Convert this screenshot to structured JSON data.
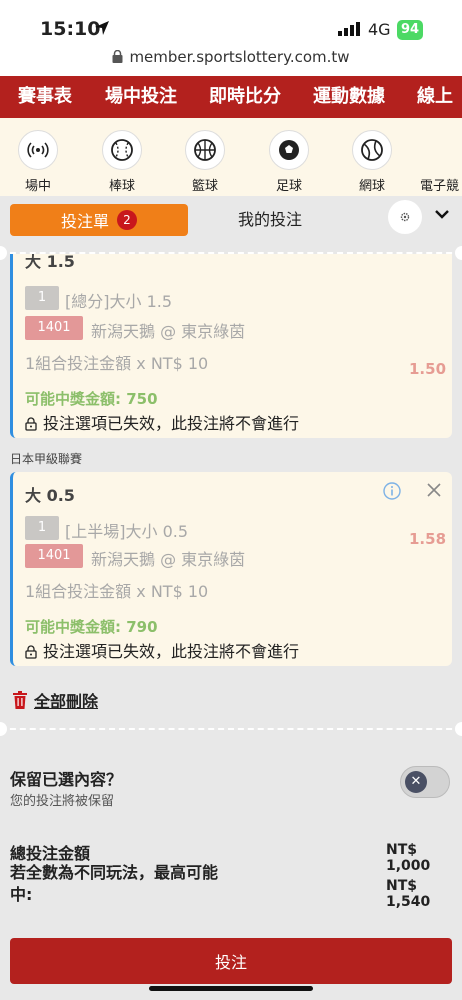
{
  "status": {
    "time": "15:10",
    "network": "4G",
    "battery": "94"
  },
  "url": "member.sportslottery.com.tw",
  "topnav": [
    "賽事表",
    "場中投注",
    "即時比分",
    "運動數據",
    "線上"
  ],
  "sports": [
    {
      "label": "場中",
      "icon": "live-signal-icon"
    },
    {
      "label": "棒球",
      "icon": "baseball-icon"
    },
    {
      "label": "籃球",
      "icon": "basketball-icon"
    },
    {
      "label": "足球",
      "icon": "soccer-icon"
    },
    {
      "label": "網球",
      "icon": "tennis-icon"
    },
    {
      "label": "電子競",
      "icon": "esports-icon"
    }
  ],
  "tabs": {
    "betslip": "投注單",
    "betslip_count": "2",
    "my_bets": "我的投注"
  },
  "bets": [
    {
      "title": "大 1.5",
      "market_no": "1",
      "market": "[總分]大小 1.5",
      "match_no": "1401",
      "match": "新潟天鵝 @ 東京綠茵",
      "odds": "1.50",
      "combo": "1組合投注金額 x NT$ 10",
      "win": "可能中獎金額: 750",
      "invalid": "投注選項已失效，此投注將不會進行"
    },
    {
      "league": "日本甲級聯賽",
      "title": "大 0.5",
      "market_no": "1",
      "market": "[上半場]大小 0.5",
      "match_no": "1401",
      "match": "新潟天鵝 @ 東京綠茵",
      "odds": "1.58",
      "combo": "1組合投注金額 x NT$ 10",
      "win": "可能中獎金額: 790",
      "invalid": "投注選項已失效，此投注將不會進行"
    }
  ],
  "delete_all": "全部刪除",
  "keep": {
    "title": "保留已選內容？",
    "subtitle": "您的投注將被保留",
    "toggle_on": false
  },
  "summary": {
    "total_label": "總投注金額",
    "total_value": "NT$ 1,000",
    "max_label": "若全數為不同玩法，最高可能中:",
    "max_value": "NT$ 1,540"
  },
  "place_bet": "投注",
  "colors": {
    "brand_red": "#b3211e",
    "tab_orange": "#f07f18",
    "card_bg": "#fdf7e8",
    "accent_blue": "#2f8ee0",
    "win_green": "#8cbf6a"
  }
}
